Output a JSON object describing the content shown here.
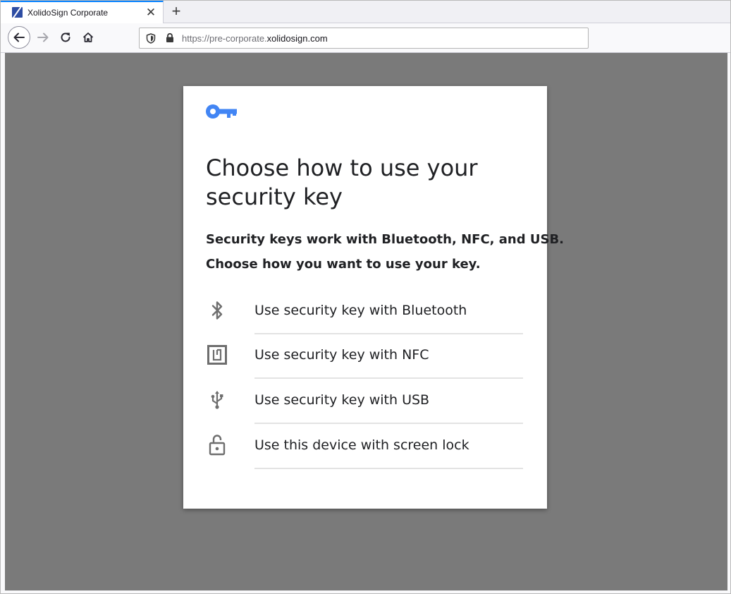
{
  "browser": {
    "tab_title": "XolidoSign Corporate",
    "url_prefix": "https://pre-corporate.",
    "url_domain": "xolidosign.com"
  },
  "card": {
    "title": "Choose how to use your security key",
    "description_line1": "Security keys work with Bluetooth, NFC, and USB.",
    "description_line2": "Choose how you want to use your key.",
    "accent_color": "#4285f4",
    "options": [
      {
        "icon": "bluetooth-icon",
        "label": "Use security key with Bluetooth"
      },
      {
        "icon": "nfc-icon",
        "label": "Use security key with NFC"
      },
      {
        "icon": "usb-icon",
        "label": "Use security key with USB"
      },
      {
        "icon": "unlock-icon",
        "label": "Use this device with screen lock"
      }
    ]
  }
}
